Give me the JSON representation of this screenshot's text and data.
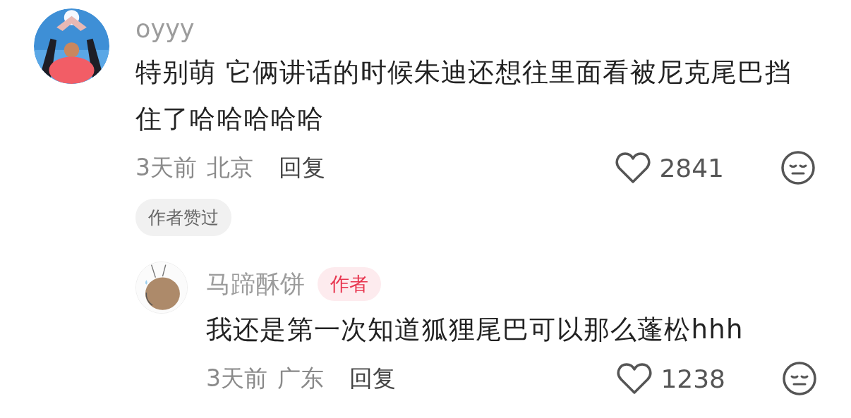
{
  "comments": [
    {
      "author": "oyyy",
      "text": "特别萌 它俩讲话的时候朱迪还想往里面看被尼克尾巴挡住了哈哈哈哈哈",
      "time": "3天前",
      "location": "北京",
      "reply_label": "回复",
      "likes": "2841",
      "liked": false,
      "badge": "作者赞过",
      "replies": [
        {
          "author": "马蹄酥饼",
          "author_tag": "作者",
          "text": "我还是第一次知道狐狸尾巴可以那么蓬松hhh",
          "time": "3天前",
          "location": "广东",
          "reply_label": "回复",
          "likes": "1238",
          "liked": false
        }
      ]
    }
  ]
}
